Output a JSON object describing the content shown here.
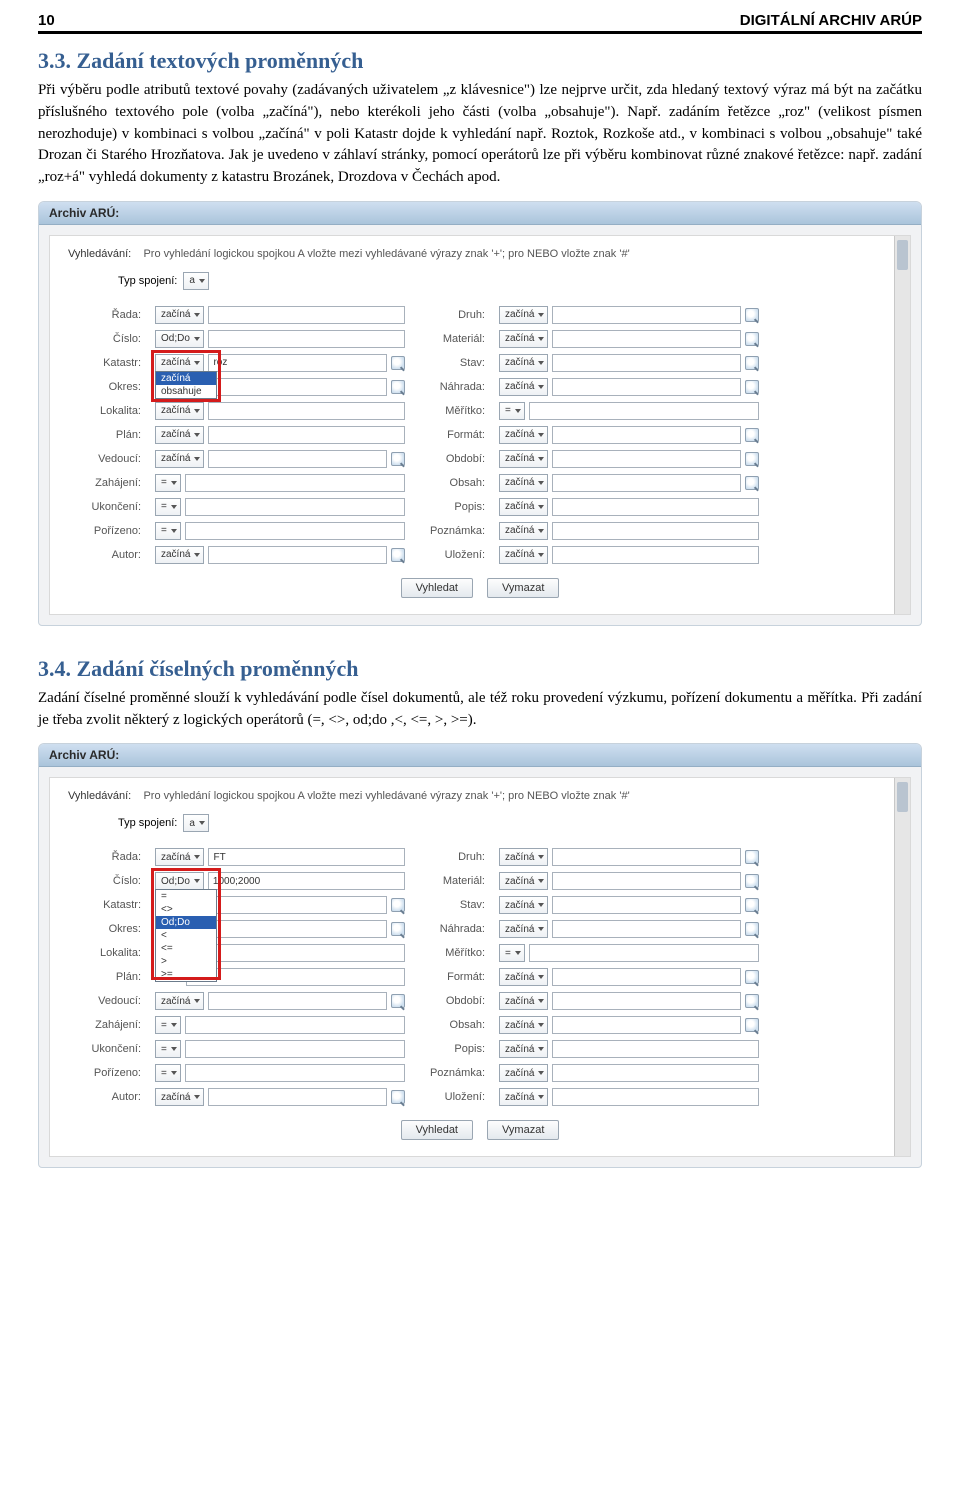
{
  "page_header": {
    "num": "10",
    "title": "DIGITÁLNÍ ARCHIV ARÚP"
  },
  "s33": {
    "heading": "3.3. Zadání textových proměnných",
    "para": "Při výběru podle atributů textové povahy (zadávaných uživatelem „z klávesnice\") lze nejprve určit, zda hledaný textový výraz má být na začátku příslušného textového pole (volba „začíná\"), nebo kterékoli jeho části (volba „obsahuje\"). Např. zadáním řetězce „roz\" (velikost písmen nerozhoduje) v kombinaci s volbou „začíná\" v poli Katastr dojde k vyhledání např. Roztok, Rozkoše atd., v kombinaci s volbou „obsahuje\" také Drozan či Starého Hrozňatova. Jak je uvedeno v záhlaví stránky, pomocí operátorů lze při výběru kombinovat různé znakové řetězce: např. zadání „roz+á\" vyhledá dokumenty z katastru Brozánek, Drozdova v Čechách apod."
  },
  "s34": {
    "heading": "3.4. Zadání číselných proměnných",
    "para": "Zadání číselné proměnné slouží k vyhledávání podle čísel dokumentů, ale též roku provedení výzkumu, pořízení dokumentu a měřítka. Při zadání je třeba zvolit některý z logických operátorů (=, <>, od;do ,<, <=, >, >=)."
  },
  "app": {
    "title": "Archiv ARÚ:",
    "hint_label": "Vyhledávání:",
    "hint_text": "Pro vyhledání logickou spojkou A vložte mezi vyhledávané výrazy znak '+'; pro NEBO vložte znak '#'",
    "typ_label": "Typ spojení:",
    "typ_value": "a",
    "btn_search": "Vyhledat",
    "btn_clear": "Vymazat"
  },
  "labels": {
    "rada": "Řada:",
    "druh": "Druh:",
    "cislo": "Číslo:",
    "material": "Materiál:",
    "katastr": "Katastr:",
    "stav": "Stav:",
    "okres": "Okres:",
    "nahrada": "Náhrada:",
    "lokalita": "Lokalita:",
    "meritko": "Měřítko:",
    "plan": "Plán:",
    "format": "Formát:",
    "vedouci": "Vedoucí:",
    "obdobi": "Období:",
    "zahajeni": "Zahájení:",
    "obsah": "Obsah:",
    "ukonceni": "Ukončení:",
    "popis": "Popis:",
    "porizeno": "Pořízeno:",
    "poznamka": "Poznámka:",
    "autor": "Autor:",
    "ulozeni": "Uložení:"
  },
  "sel": {
    "zacina": "začíná",
    "obsahuje": "obsahuje",
    "oddo": "Od;Do",
    "eq": "="
  },
  "shot1": {
    "katastr_value": "roz",
    "dd_opts": [
      "začíná",
      "obsahuje"
    ]
  },
  "shot2": {
    "rada_value": "FT",
    "cislo_value": "1000;2000",
    "dd_opts": [
      "=",
      "<>",
      "Od;Do",
      "<",
      "<=",
      ">",
      ">="
    ]
  }
}
